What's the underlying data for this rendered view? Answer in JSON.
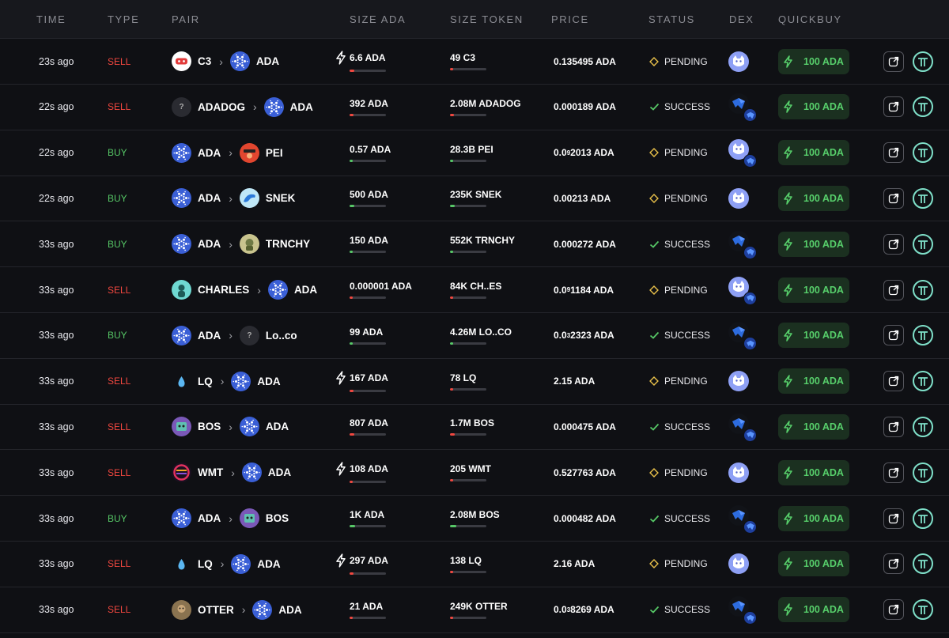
{
  "colors": {
    "sell": "#f0473f",
    "buy": "#56c766",
    "quickbuy_bg": "#1b3020",
    "quickbuy_text": "#57cf6b",
    "pending": "#e8c04a",
    "success": "#56c766",
    "header_bg": "#17181d",
    "page_bg": "#0f1014"
  },
  "header": {
    "time": "TIME",
    "type": "TYPE",
    "pair": "PAIR",
    "size_ada": "SIZE ADA",
    "size_token": "SIZE TOKEN",
    "price": "PRICE",
    "status": "STATUS",
    "dex": "DEX",
    "quickbuy": "QUICKBUY"
  },
  "rows": [
    {
      "time": "23s ago",
      "type": "SELL",
      "from": {
        "name": "C3",
        "icon": "c3-token-icon"
      },
      "to": {
        "name": "ADA",
        "icon": "ada-token-icon"
      },
      "size_ada": "6.6 ADA",
      "size_ada_bolt": true,
      "size_ada_fill": 0.12,
      "size_token": "49 C3",
      "size_token_fill": 0.08,
      "price": {
        "main": "0.135495 ADA"
      },
      "status": "PENDING",
      "dex": "minswap",
      "quickbuy": "100 ADA"
    },
    {
      "time": "22s ago",
      "type": "SELL",
      "from": {
        "name": "ADADOG",
        "icon": "unknown-token-icon",
        "glyph": "?"
      },
      "to": {
        "name": "ADA",
        "icon": "ada-token-icon"
      },
      "size_ada": "392 ADA",
      "size_ada_bolt": false,
      "size_ada_fill": 0.1,
      "size_token": "2.08M ADADOG",
      "size_token_fill": 0.1,
      "price": {
        "main": "0.000189 ADA"
      },
      "status": "SUCCESS",
      "dex": "splash-minswap",
      "quickbuy": "100 ADA"
    },
    {
      "time": "22s ago",
      "type": "BUY",
      "from": {
        "name": "ADA",
        "icon": "ada-token-icon"
      },
      "to": {
        "name": "PEI",
        "icon": "pei-token-icon"
      },
      "size_ada": "0.57 ADA",
      "size_ada_bolt": false,
      "size_ada_fill": 0.08,
      "size_token": "28.3B PEI",
      "size_token_fill": 0.06,
      "price": {
        "pre": "0.0",
        "sub": "9",
        "post": "2013 ADA"
      },
      "status": "PENDING",
      "dex": "minswap-splash",
      "quickbuy": "100 ADA"
    },
    {
      "time": "22s ago",
      "type": "BUY",
      "from": {
        "name": "ADA",
        "icon": "ada-token-icon"
      },
      "to": {
        "name": "SNEK",
        "icon": "snek-token-icon"
      },
      "size_ada": "500 ADA",
      "size_ada_bolt": false,
      "size_ada_fill": 0.12,
      "size_token": "235K SNEK",
      "size_token_fill": 0.14,
      "price": {
        "main": "0.00213 ADA"
      },
      "status": "PENDING",
      "dex": "minswap",
      "quickbuy": "100 ADA"
    },
    {
      "time": "33s ago",
      "type": "BUY",
      "from": {
        "name": "ADA",
        "icon": "ada-token-icon"
      },
      "to": {
        "name": "TRNCHY",
        "icon": "trnchy-token-icon"
      },
      "size_ada": "150 ADA",
      "size_ada_bolt": false,
      "size_ada_fill": 0.08,
      "size_token": "552K TRNCHY",
      "size_token_fill": 0.06,
      "price": {
        "main": "0.000272 ADA"
      },
      "status": "SUCCESS",
      "dex": "splash-splash",
      "quickbuy": "100 ADA"
    },
    {
      "time": "33s ago",
      "type": "SELL",
      "from": {
        "name": "CHARLES",
        "icon": "charles-token-icon"
      },
      "to": {
        "name": "ADA",
        "icon": "ada-token-icon"
      },
      "size_ada": "0.000001 ADA",
      "size_ada_bolt": false,
      "size_ada_fill": 0.08,
      "size_token": "84K CH..ES",
      "size_token_fill": 0.06,
      "price": {
        "pre": "0.0",
        "sub": "9",
        "post": "1184 ADA"
      },
      "status": "PENDING",
      "dex": "minswap-splash",
      "quickbuy": "100 ADA"
    },
    {
      "time": "33s ago",
      "type": "BUY",
      "from": {
        "name": "ADA",
        "icon": "ada-token-icon"
      },
      "to": {
        "name": "Lo..co",
        "icon": "unknown-token-icon",
        "glyph": "?"
      },
      "size_ada": "99 ADA",
      "size_ada_bolt": false,
      "size_ada_fill": 0.06,
      "size_token": "4.26M LO..CO",
      "size_token_fill": 0.06,
      "price": {
        "pre": "0.0",
        "sub": "3",
        "post": "2323 ADA"
      },
      "status": "SUCCESS",
      "dex": "splash-splash",
      "quickbuy": "100 ADA"
    },
    {
      "time": "33s ago",
      "type": "SELL",
      "from": {
        "name": "LQ",
        "icon": "lq-token-icon"
      },
      "to": {
        "name": "ADA",
        "icon": "ada-token-icon"
      },
      "size_ada": "167 ADA",
      "size_ada_bolt": true,
      "size_ada_fill": 0.1,
      "size_token": "78 LQ",
      "size_token_fill": 0.06,
      "price": {
        "main": "2.15 ADA"
      },
      "status": "PENDING",
      "dex": "minswap",
      "quickbuy": "100 ADA"
    },
    {
      "time": "33s ago",
      "type": "SELL",
      "from": {
        "name": "BOS",
        "icon": "bos-token-icon"
      },
      "to": {
        "name": "ADA",
        "icon": "ada-token-icon"
      },
      "size_ada": "807 ADA",
      "size_ada_bolt": false,
      "size_ada_fill": 0.14,
      "size_token": "1.7M BOS",
      "size_token_fill": 0.12,
      "price": {
        "main": "0.000475 ADA"
      },
      "status": "SUCCESS",
      "dex": "splash-splash",
      "quickbuy": "100 ADA"
    },
    {
      "time": "33s ago",
      "type": "SELL",
      "from": {
        "name": "WMT",
        "icon": "wmt-token-icon"
      },
      "to": {
        "name": "ADA",
        "icon": "ada-token-icon"
      },
      "size_ada": "108 ADA",
      "size_ada_bolt": true,
      "size_ada_fill": 0.08,
      "size_token": "205 WMT",
      "size_token_fill": 0.06,
      "price": {
        "main": "0.527763 ADA"
      },
      "status": "PENDING",
      "dex": "minswap",
      "quickbuy": "100 ADA"
    },
    {
      "time": "33s ago",
      "type": "BUY",
      "from": {
        "name": "ADA",
        "icon": "ada-token-icon"
      },
      "to": {
        "name": "BOS",
        "icon": "bos-token-icon"
      },
      "size_ada": "1K ADA",
      "size_ada_bolt": false,
      "size_ada_fill": 0.16,
      "size_token": "2.08M BOS",
      "size_token_fill": 0.18,
      "price": {
        "main": "0.000482 ADA"
      },
      "status": "SUCCESS",
      "dex": "splash-splash",
      "quickbuy": "100 ADA"
    },
    {
      "time": "33s ago",
      "type": "SELL",
      "from": {
        "name": "LQ",
        "icon": "lq-token-icon"
      },
      "to": {
        "name": "ADA",
        "icon": "ada-token-icon"
      },
      "size_ada": "297 ADA",
      "size_ada_bolt": true,
      "size_ada_fill": 0.1,
      "size_token": "138 LQ",
      "size_token_fill": 0.06,
      "price": {
        "main": "2.16 ADA"
      },
      "status": "PENDING",
      "dex": "minswap",
      "quickbuy": "100 ADA"
    },
    {
      "time": "33s ago",
      "type": "SELL",
      "from": {
        "name": "OTTER",
        "icon": "otter-token-icon"
      },
      "to": {
        "name": "ADA",
        "icon": "ada-token-icon"
      },
      "size_ada": "21 ADA",
      "size_ada_bolt": false,
      "size_ada_fill": 0.06,
      "size_token": "249K OTTER",
      "size_token_fill": 0.08,
      "price": {
        "pre": "0.0",
        "sub": "3",
        "post": "8269 ADA"
      },
      "status": "SUCCESS",
      "dex": "splash-splash",
      "quickbuy": "100 ADA"
    }
  ]
}
